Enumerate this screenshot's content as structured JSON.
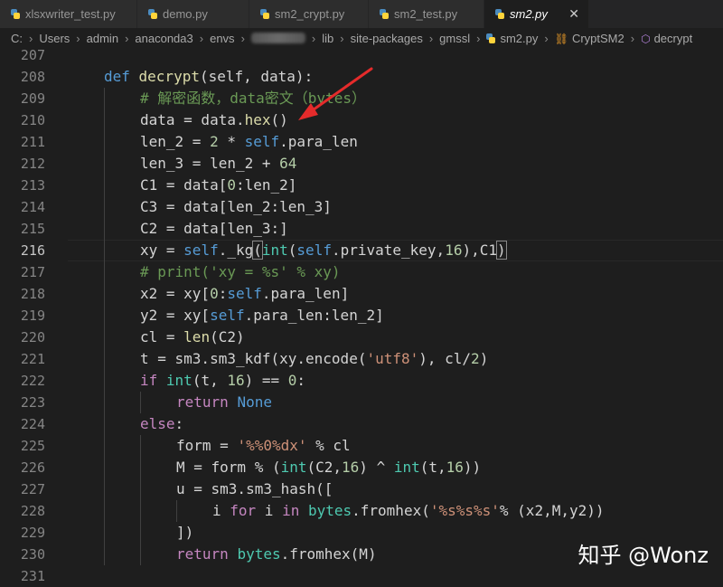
{
  "tabs": [
    {
      "label": "xlsxwriter_test.py",
      "active": false,
      "width": 152
    },
    {
      "label": "demo.py",
      "active": false,
      "width": 124
    },
    {
      "label": "sm2_crypt.py",
      "active": false,
      "width": 132
    },
    {
      "label": "sm2_test.py",
      "active": false,
      "width": 128
    },
    {
      "label": "sm2.py",
      "active": true,
      "width": 116,
      "close": "✕"
    }
  ],
  "breadcrumb": {
    "parts": [
      "C:",
      "Users",
      "admin",
      "anaconda3",
      "envs",
      "",
      "lib",
      "site-packages",
      "gmssl",
      "sm2.py",
      "CryptSM2",
      "decrypt"
    ]
  },
  "editor": {
    "current_line": "216",
    "lines": [
      {
        "n": "207",
        "tokens": []
      },
      {
        "n": "208",
        "indent": 1,
        "tokens": [
          [
            "kw",
            "def "
          ],
          [
            "fn",
            "decrypt"
          ],
          [
            "",
            "(self, data):"
          ]
        ]
      },
      {
        "n": "209",
        "indent": 2,
        "tokens": [
          [
            "cm",
            "# 解密函数，data密文（bytes）"
          ]
        ]
      },
      {
        "n": "210",
        "indent": 2,
        "tokens": [
          [
            "",
            "data = data."
          ],
          [
            "fn",
            "hex"
          ],
          [
            "",
            "()"
          ]
        ]
      },
      {
        "n": "211",
        "indent": 2,
        "tokens": [
          [
            "",
            "len_2 = "
          ],
          [
            "num",
            "2"
          ],
          [
            "",
            " * "
          ],
          [
            "kw",
            "self"
          ],
          [
            "",
            ".para_len"
          ]
        ]
      },
      {
        "n": "212",
        "indent": 2,
        "tokens": [
          [
            "",
            "len_3 = len_2 + "
          ],
          [
            "num",
            "64"
          ]
        ]
      },
      {
        "n": "213",
        "indent": 2,
        "tokens": [
          [
            "",
            "C1 = data["
          ],
          [
            "num",
            "0"
          ],
          [
            "",
            ":len_2]"
          ]
        ]
      },
      {
        "n": "214",
        "indent": 2,
        "tokens": [
          [
            "",
            "C3 = data[len_2:len_3]"
          ]
        ]
      },
      {
        "n": "215",
        "indent": 2,
        "tokens": [
          [
            "",
            "C2 = data[len_3:]"
          ]
        ]
      },
      {
        "n": "216",
        "indent": 2,
        "tokens": [
          [
            "",
            "xy = "
          ],
          [
            "kw",
            "self"
          ],
          [
            "",
            "._kg"
          ],
          [
            "bracket",
            "("
          ],
          [
            "bi",
            "int"
          ],
          [
            "",
            "("
          ],
          [
            "kw",
            "self"
          ],
          [
            "",
            ".private_key,"
          ],
          [
            "num",
            "16"
          ],
          [
            "",
            "),C1"
          ],
          [
            "bracket",
            ")"
          ]
        ]
      },
      {
        "n": "217",
        "indent": 2,
        "tokens": [
          [
            "cm",
            "# print('xy = %s' % xy)"
          ]
        ]
      },
      {
        "n": "218",
        "indent": 2,
        "tokens": [
          [
            "",
            "x2 = xy["
          ],
          [
            "num",
            "0"
          ],
          [
            "",
            ":"
          ],
          [
            "kw",
            "self"
          ],
          [
            "",
            ".para_len]"
          ]
        ]
      },
      {
        "n": "219",
        "indent": 2,
        "tokens": [
          [
            "",
            "y2 = xy["
          ],
          [
            "kw",
            "self"
          ],
          [
            "",
            ".para_len:len_2]"
          ]
        ]
      },
      {
        "n": "220",
        "indent": 2,
        "tokens": [
          [
            "",
            "cl = "
          ],
          [
            "fn",
            "len"
          ],
          [
            "",
            "(C2)"
          ]
        ]
      },
      {
        "n": "221",
        "indent": 2,
        "tokens": [
          [
            "",
            "t = sm3.sm3_kdf(xy.encode("
          ],
          [
            "str",
            "'utf8'"
          ],
          [
            "",
            "), cl/"
          ],
          [
            "num",
            "2"
          ],
          [
            "",
            ")"
          ]
        ]
      },
      {
        "n": "222",
        "indent": 2,
        "tokens": [
          [
            "ctl",
            "if "
          ],
          [
            "bi",
            "int"
          ],
          [
            "",
            "(t, "
          ],
          [
            "num",
            "16"
          ],
          [
            "",
            ") == "
          ],
          [
            "num",
            "0"
          ],
          [
            "",
            ":"
          ]
        ]
      },
      {
        "n": "223",
        "indent": 3,
        "tokens": [
          [
            "ctl",
            "return "
          ],
          [
            "kw",
            "None"
          ]
        ]
      },
      {
        "n": "224",
        "indent": 2,
        "tokens": [
          [
            "ctl",
            "else"
          ],
          [
            "",
            ":"
          ]
        ]
      },
      {
        "n": "225",
        "indent": 3,
        "tokens": [
          [
            "",
            "form = "
          ],
          [
            "str",
            "'%%0%dx'"
          ],
          [
            "",
            " % cl"
          ]
        ]
      },
      {
        "n": "226",
        "indent": 3,
        "tokens": [
          [
            "",
            "M = form % ("
          ],
          [
            "bi",
            "int"
          ],
          [
            "",
            "(C2,"
          ],
          [
            "num",
            "16"
          ],
          [
            "",
            ") ^ "
          ],
          [
            "bi",
            "int"
          ],
          [
            "",
            "(t,"
          ],
          [
            "num",
            "16"
          ],
          [
            "",
            "))"
          ]
        ]
      },
      {
        "n": "227",
        "indent": 3,
        "tokens": [
          [
            "",
            "u = sm3.sm3_hash(["
          ]
        ]
      },
      {
        "n": "228",
        "indent": 4,
        "tokens": [
          [
            "",
            "i "
          ],
          [
            "ctl",
            "for"
          ],
          [
            "",
            " i "
          ],
          [
            "ctl",
            "in"
          ],
          [
            "",
            ""
          ],
          [
            "bi",
            " bytes"
          ],
          [
            "",
            ".fromhex("
          ],
          [
            "str",
            "'%s%s%s'"
          ],
          [
            "",
            "% (x2,M,y2))"
          ]
        ]
      },
      {
        "n": "229",
        "indent": 3,
        "tokens": [
          [
            "",
            "])"
          ]
        ]
      },
      {
        "n": "230",
        "indent": 3,
        "tokens": [
          [
            "ctl",
            "return "
          ],
          [
            "bi",
            "bytes"
          ],
          [
            "",
            ".fromhex(M)"
          ]
        ]
      },
      {
        "n": "231",
        "tokens": []
      }
    ]
  },
  "watermark": "知乎 @Wonz",
  "colors": {
    "arrow": "#e52b2b",
    "background": "#1e1e1e"
  }
}
